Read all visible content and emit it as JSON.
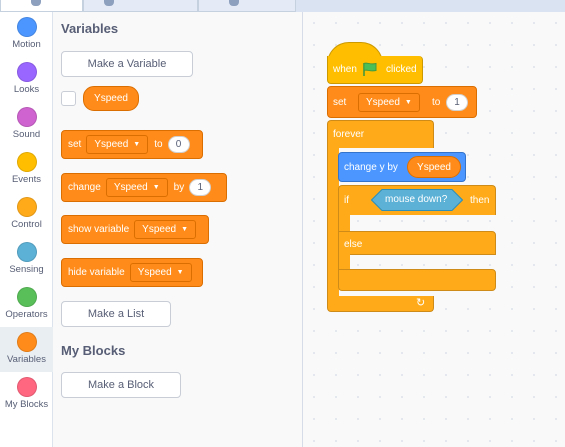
{
  "categories": [
    {
      "label": "Motion",
      "color": "#4c97ff",
      "icon": "motion-category-icon"
    },
    {
      "label": "Looks",
      "color": "#9966ff",
      "icon": "looks-category-icon"
    },
    {
      "label": "Sound",
      "color": "#cf63cf",
      "icon": "sound-category-icon"
    },
    {
      "label": "Events",
      "color": "#ffbf00",
      "icon": "events-category-icon"
    },
    {
      "label": "Control",
      "color": "#ffab19",
      "icon": "control-category-icon"
    },
    {
      "label": "Sensing",
      "color": "#5cb1d6",
      "icon": "sensing-category-icon"
    },
    {
      "label": "Operators",
      "color": "#59c059",
      "icon": "operators-category-icon"
    },
    {
      "label": "Variables",
      "color": "#ff8c1a",
      "icon": "variables-category-icon"
    },
    {
      "label": "My Blocks",
      "color": "#ff6680",
      "icon": "myblocks-category-icon"
    }
  ],
  "selected_category": "Variables",
  "palette": {
    "variables_heading": "Variables",
    "make_variable": "Make a Variable",
    "variable_name": "Yspeed",
    "set_block": {
      "word": "set",
      "var": "Yspeed",
      "to": "to",
      "value": "0"
    },
    "change_block": {
      "word": "change",
      "var": "Yspeed",
      "by": "by",
      "value": "1"
    },
    "show_block": {
      "word": "show variable",
      "var": "Yspeed"
    },
    "hide_block": {
      "word": "hide variable",
      "var": "Yspeed"
    },
    "make_list": "Make a List",
    "myblocks_heading": "My Blocks",
    "make_block": "Make a Block"
  },
  "script": {
    "hat": {
      "when": "when",
      "clicked": "clicked",
      "icon": "green-flag-icon"
    },
    "set": {
      "word": "set",
      "var": "Yspeed",
      "to": "to",
      "value": "1"
    },
    "forever": "forever",
    "change_y": {
      "word": "change y by",
      "reporter": "Yspeed"
    },
    "if_else": {
      "if": "if",
      "condition": "mouse down?",
      "then": "then",
      "else": "else"
    },
    "loop_icon": "loop-arrow-icon"
  },
  "colors": {
    "variables": "#ff8c1a",
    "control": "#ffab19",
    "events": "#ffbf00",
    "motion": "#4c97ff",
    "sensing": "#5cb1d6"
  }
}
